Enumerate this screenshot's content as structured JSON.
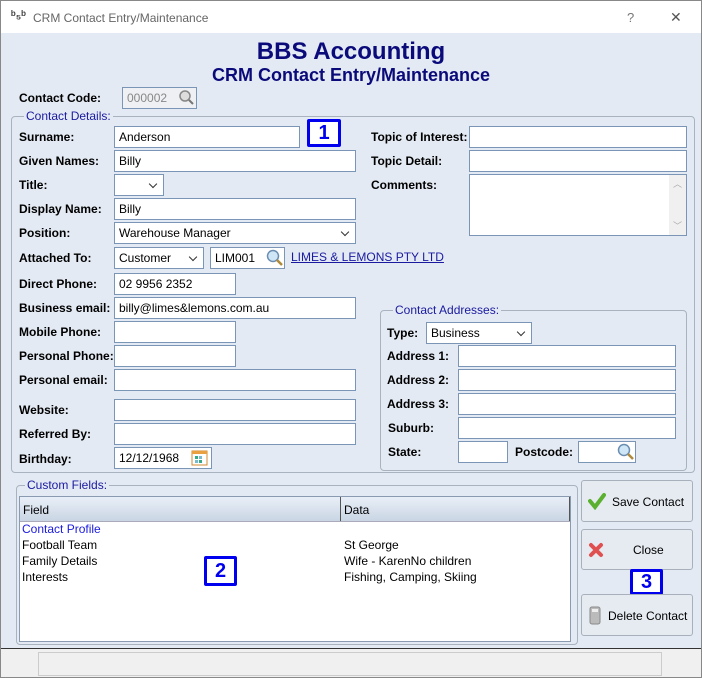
{
  "window": {
    "title": "CRM Contact Entry/Maintenance",
    "help": "?",
    "close": "✕"
  },
  "header": {
    "title": "BBS Accounting",
    "subtitle": "CRM Contact Entry/Maintenance"
  },
  "contact_code": {
    "label": "Contact Code:",
    "value": "000002"
  },
  "contact_details": {
    "legend": "Contact Details:",
    "surname": {
      "label": "Surname:",
      "value": "Anderson"
    },
    "given_names": {
      "label": "Given Names:",
      "value": "Billy"
    },
    "title": {
      "label": "Title:",
      "value": ""
    },
    "display_name": {
      "label": "Display Name:",
      "value": "Billy"
    },
    "position": {
      "label": "Position:",
      "value": "Warehouse Manager"
    },
    "attached_to": {
      "label": "Attached To:",
      "type": "Customer",
      "code": "LIM001",
      "link": "LIMES & LEMONS PTY LTD"
    },
    "direct_phone": {
      "label": "Direct Phone:",
      "value": "02 9956 2352"
    },
    "business_email": {
      "label": "Business email:",
      "value": "billy@limes&lemons.com.au"
    },
    "mobile_phone": {
      "label": "Mobile Phone:",
      "value": ""
    },
    "personal_phone": {
      "label": "Personal Phone:",
      "value": ""
    },
    "personal_email": {
      "label": "Personal email:",
      "value": ""
    },
    "website": {
      "label": "Website:",
      "value": ""
    },
    "referred_by": {
      "label": "Referred By:",
      "value": ""
    },
    "birthday": {
      "label": "Birthday:",
      "value": "12/12/1968"
    },
    "topic_of_interest": {
      "label": "Topic of Interest:",
      "value": ""
    },
    "topic_detail": {
      "label": "Topic Detail:",
      "value": ""
    },
    "comments": {
      "label": "Comments:",
      "value": ""
    }
  },
  "addresses": {
    "legend": "Contact Addresses:",
    "type": {
      "label": "Type:",
      "value": "Business"
    },
    "address1": {
      "label": "Address 1:",
      "value": ""
    },
    "address2": {
      "label": "Address 2:",
      "value": ""
    },
    "address3": {
      "label": "Address 3:",
      "value": ""
    },
    "suburb": {
      "label": "Suburb:",
      "value": ""
    },
    "state": {
      "label": "State:",
      "value": ""
    },
    "postcode": {
      "label": "Postcode:",
      "value": ""
    }
  },
  "custom_fields": {
    "legend": "Custom Fields:",
    "columns": [
      "Field",
      "Data"
    ],
    "rows": [
      {
        "field": "Contact Profile",
        "data": ""
      },
      {
        "field": "Football Team",
        "data": "St George"
      },
      {
        "field": "Family Details",
        "data": "Wife - KarenNo children"
      },
      {
        "field": "Interests",
        "data": "Fishing, Camping, Skiing"
      }
    ]
  },
  "buttons": {
    "save": "Save Contact",
    "close": "Close",
    "delete": "Delete Contact"
  },
  "markers": [
    "1",
    "2",
    "3"
  ],
  "colors": {
    "heading": "#0a0a7a",
    "marker": "#0000ee",
    "background": "#e3eaf3",
    "group_header_row": "#1a1aa0"
  }
}
